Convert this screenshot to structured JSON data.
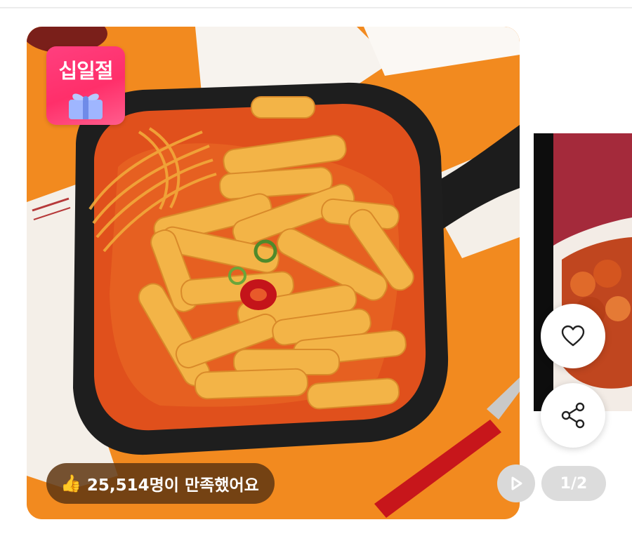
{
  "product": {
    "event_badge": "십일절",
    "satisfaction_text": "25,514명이 만족했어요",
    "thumb_icon": "thumbs-up-icon"
  },
  "carousel": {
    "current_page": "1",
    "total_pages": "2",
    "page_counter": "1/2"
  },
  "actions": {
    "like_icon": "heart-icon",
    "share_icon": "share-icon",
    "play_icon": "play-icon"
  },
  "colors": {
    "background_orange": "#f28a1f",
    "badge_pink": "#ff3f7f",
    "pill_brown": "#5f3712"
  }
}
